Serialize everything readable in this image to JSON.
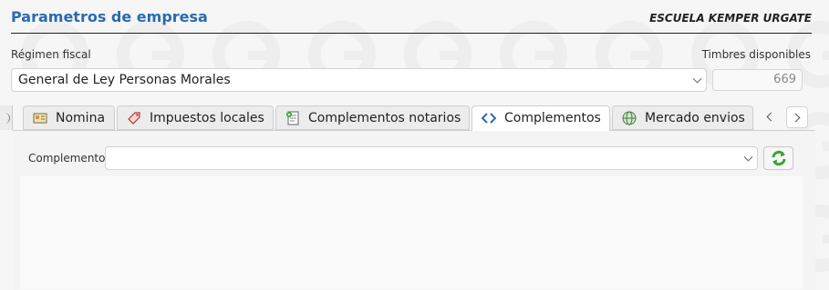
{
  "header": {
    "title": "Parametros de empresa",
    "company": "ESCUELA KEMPER URGATE"
  },
  "regimen": {
    "label": "Régimen fiscal",
    "value": "General de Ley Personas Morales"
  },
  "timbres": {
    "label": "Timbres disponibles",
    "value": "669"
  },
  "tabs": [
    {
      "label": "Nomina",
      "icon": "nomina-icon"
    },
    {
      "label": "Impuestos locales",
      "icon": "tag-icon"
    },
    {
      "label": "Complementos notarios",
      "icon": "notary-document-icon"
    },
    {
      "label": "Complementos",
      "icon": "code-arrows-icon",
      "active": true
    },
    {
      "label": "Mercado envios",
      "icon": "globe-icon"
    }
  ],
  "complemento": {
    "label": "Complemento",
    "value": ""
  },
  "colors": {
    "title_blue": "#2a6ab1",
    "refresh_green": "#3aa335"
  }
}
